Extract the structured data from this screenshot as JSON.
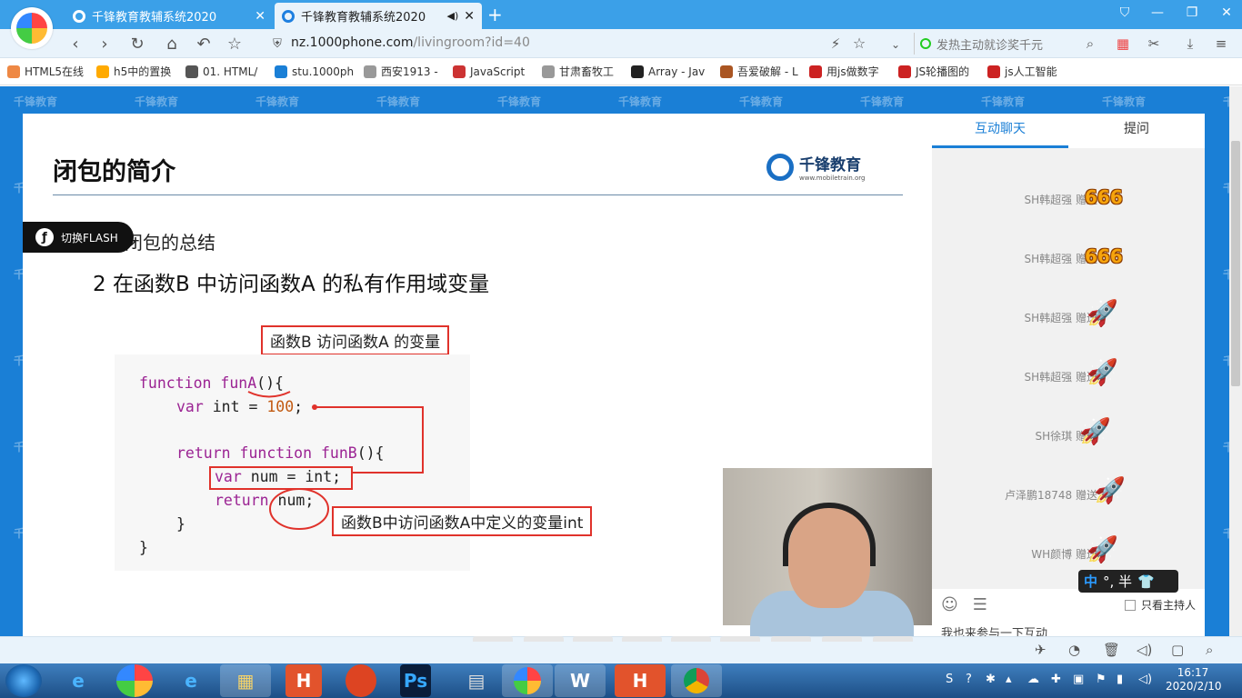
{
  "browser": {
    "tabs": [
      {
        "title": "千锋教育教辅系统2020",
        "close": "✕"
      },
      {
        "title": "千锋教育教辅系统2020",
        "close": "✕",
        "sound": "◀)"
      }
    ],
    "new_tab": "+",
    "window_controls": [
      "⛉",
      "—",
      "❐",
      "✕"
    ]
  },
  "address": {
    "url_host": "nz.1000phone.com",
    "url_path": "/livingroom?id=40",
    "search_placeholder": "发热主动就诊奖千元"
  },
  "bookmarks": [
    {
      "label": "HTML5在线",
      "color": "#e84"
    },
    {
      "label": "h5中的置换",
      "color": "#fa0"
    },
    {
      "label": "01. HTML/",
      "color": "#555"
    },
    {
      "label": "stu.1000ph",
      "color": "#1a7fd6"
    },
    {
      "label": "西安1913 -",
      "color": "#999"
    },
    {
      "label": "JavaScript",
      "color": "#c33"
    },
    {
      "label": "甘肃畜牧工",
      "color": "#999"
    },
    {
      "label": "Array - Jav",
      "color": "#222"
    },
    {
      "label": "吾爱破解 - L",
      "color": "#a52"
    },
    {
      "label": "用js做数字",
      "color": "#c22"
    },
    {
      "label": "JS轮播图的",
      "color": "#c22"
    },
    {
      "label": "js人工智能",
      "color": "#c22"
    }
  ],
  "slide": {
    "title": "闭包的简介",
    "logo_text": "千锋教育",
    "logo_sub": "www.mobiletrain.org",
    "summary": "闭包的总结",
    "point": "2 在函数B 中访问函数A 的私有作用域变量",
    "callout_top": "函数B 访问函数A 的变量",
    "callout_bottom": "函数B中访问函数A中定义的变量int",
    "code": {
      "l1a": "function",
      "l1b": " funA",
      "l1c": "(){",
      "l2a": "var",
      "l2b": " int = ",
      "l2c": "100",
      "l2d": ";",
      "l3a": "return",
      "l3b": " function",
      "l3c": " funB",
      "l3d": "(){",
      "l4a": "var",
      "l4b": " num = int;",
      "l5a": "return",
      "l5b": " num;",
      "l6": "}",
      "l7": "}"
    }
  },
  "watermark": "千锋教育",
  "flash_button": "切换FLASH",
  "chat": {
    "tabs": [
      "互动聊天",
      "提问"
    ],
    "messages": [
      {
        "sender": "SH韩超强 赠送",
        "gift": "666"
      },
      {
        "sender": "SH韩超强 赠送",
        "gift": "666"
      },
      {
        "sender": "SH韩超强 赠送",
        "gift": "rocket"
      },
      {
        "sender": "SH韩超强 赠送",
        "gift": "rocket"
      },
      {
        "sender": "SH徐琪 赠送",
        "gift": "rocket"
      },
      {
        "sender": "卢泽鹏18748 赠送",
        "gift": "rocket"
      },
      {
        "sender": "WH颜博 赠送",
        "gift": "rocket"
      }
    ],
    "host_only": "只看主持人",
    "input_placeholder": "我也来参与一下互动"
  },
  "ime": {
    "mode": "中",
    "punct": "°, 半"
  },
  "taskbar": {
    "time": "16:17",
    "date": "2020/2/10",
    "apps": [
      "e",
      "",
      "e",
      "▦",
      "H",
      "",
      "Ps",
      "▤",
      "",
      "W",
      "H",
      ""
    ]
  }
}
